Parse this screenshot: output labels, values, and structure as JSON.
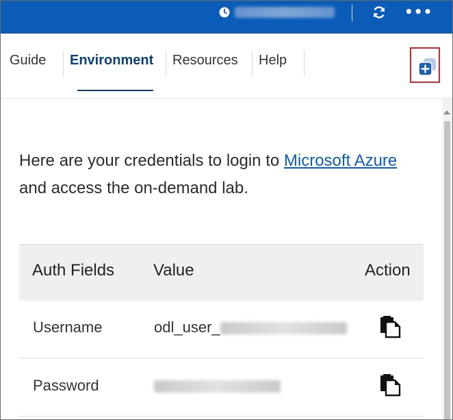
{
  "header": {
    "timer_icon": "clock-icon",
    "refresh_icon": "refresh-icon",
    "more_icon": "more-icon",
    "more_label": "•••",
    "bar_color": "#0b5cb8"
  },
  "tabs": [
    {
      "label": "Guide"
    },
    {
      "label": "Environment",
      "active": true
    },
    {
      "label": "Resources"
    },
    {
      "label": "Help"
    }
  ],
  "popout_icon": "popout-window-icon",
  "intro": {
    "text_before": "Here are your credentials to login to ",
    "link": "Microsoft Azure",
    "text_after": " and access the on-demand lab."
  },
  "table": {
    "headers": [
      "Auth Fields",
      "Value",
      "Action"
    ],
    "rows": [
      {
        "field": "Username",
        "value_prefix": "odl_user_",
        "action_icon": "copy-icon"
      },
      {
        "field": "Password",
        "value_prefix": "",
        "action_icon": "copy-icon"
      }
    ]
  },
  "colors": {
    "accent": "#0b3f7a",
    "link": "#0b5cb8",
    "highlight_border": "#e0222a"
  }
}
